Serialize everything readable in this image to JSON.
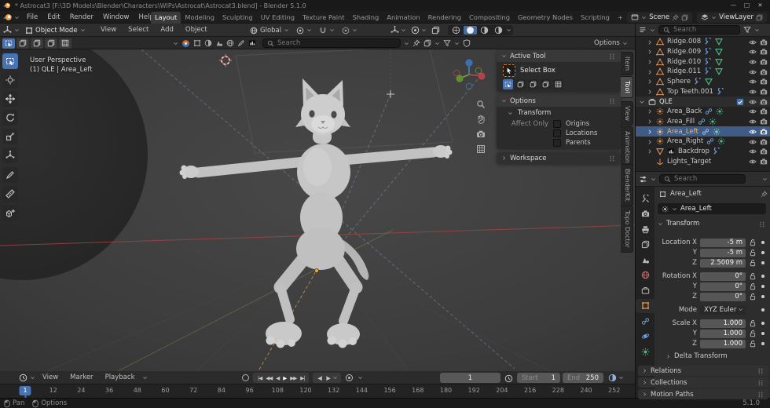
{
  "window": {
    "title": "* Astrocat3 [F:\\3D Models\\Blender\\Characters\\WIPs\\Astrocat\\Astrocat3.blend] - Blender 5.1.0",
    "controls": {
      "minimize": "—",
      "maximize": "□",
      "close": "✕"
    }
  },
  "topbar": {
    "menus": [
      "File",
      "Edit",
      "Render",
      "Window",
      "Help"
    ],
    "workspaces": [
      "Layout",
      "Modeling",
      "Sculpting",
      "UV Editing",
      "Texture Paint",
      "Shading",
      "Animation",
      "Rendering",
      "Compositing",
      "Geometry Nodes",
      "Scripting"
    ],
    "active_workspace": "Layout",
    "add_workspace": "+",
    "scene_label": "Scene",
    "view_layer_label": "ViewLayer"
  },
  "viewport_header": {
    "mode": "Object Mode",
    "menus": [
      "View",
      "Select",
      "Add",
      "Object"
    ],
    "orientation": "Global"
  },
  "tool_settings": {
    "search_placeholder": "Search",
    "options_label": "Options"
  },
  "viewport": {
    "overlay_title": "User Perspective",
    "overlay_subtitle": "(1) QLE | Area_Left"
  },
  "sidebar": {
    "tabs": [
      "Item",
      "Tool",
      "View",
      "Animation",
      "BlenderKit",
      "Topo Doctor"
    ],
    "active_tab": "Tool",
    "active_tool_panel": {
      "title": "Active Tool",
      "tool_name": "Select Box"
    },
    "options_panel": {
      "title": "Options",
      "transform": "Transform",
      "affect_only": "Affect Only",
      "toggles": [
        "Origins",
        "Locations",
        "Parents"
      ]
    },
    "workspace_panel": {
      "title": "Workspace"
    }
  },
  "outliner": {
    "search_placeholder": "Search",
    "items": [
      {
        "name": "Ridge.008",
        "type": "mesh"
      },
      {
        "name": "Ridge.009",
        "type": "mesh"
      },
      {
        "name": "Ridge.010",
        "type": "mesh"
      },
      {
        "name": "Ridge.011",
        "type": "mesh"
      },
      {
        "name": "Sphere",
        "type": "mesh"
      },
      {
        "name": "Top Teeth.001",
        "type": "mesh"
      },
      {
        "name": "QLE",
        "type": "collection",
        "checked": true
      },
      {
        "name": "Area_Back",
        "type": "light"
      },
      {
        "name": "Area_Fill",
        "type": "light"
      },
      {
        "name": "Area_Left",
        "type": "light",
        "selected": true
      },
      {
        "name": "Area_Right",
        "type": "light"
      },
      {
        "name": "Backdrop",
        "type": "mesh"
      },
      {
        "name": "Lights_Target",
        "type": "empty"
      }
    ]
  },
  "properties": {
    "search_placeholder": "Search",
    "breadcrumb": "Area_Left",
    "name_field": "Area_Left",
    "transform": {
      "title": "Transform",
      "rows": [
        {
          "label": "Location X",
          "value": "-5 m"
        },
        {
          "label": "Y",
          "value": "-5 m"
        },
        {
          "label": "Z",
          "value": "2.5009 m"
        },
        {
          "label": "Rotation X",
          "value": "0°"
        },
        {
          "label": "Y",
          "value": "0°"
        },
        {
          "label": "Z",
          "value": "0°"
        },
        {
          "label": "Mode",
          "value": "XYZ Euler"
        },
        {
          "label": "Scale X",
          "value": "1.000"
        },
        {
          "label": "Y",
          "value": "1.000"
        },
        {
          "label": "Z",
          "value": "1.000"
        }
      ],
      "delta": "Delta Transform"
    },
    "panels": [
      "Relations",
      "Collections",
      "Motion Paths"
    ]
  },
  "timeline": {
    "menus": [
      "View",
      "Marker",
      "Playback"
    ],
    "transport": [
      "|◀",
      "◀◀",
      "◀",
      "▶",
      "▶▶",
      "▶|"
    ],
    "step_buttons": [
      "◀|",
      "|▶"
    ],
    "current_frame": "1",
    "start_label": "Start",
    "start_value": "1",
    "end_label": "End",
    "end_value": "250",
    "ruler": [
      "1",
      "12",
      "24",
      "36",
      "48",
      "60",
      "72",
      "84",
      "96",
      "108",
      "120",
      "132",
      "144",
      "156",
      "168",
      "180",
      "192",
      "204",
      "216",
      "228",
      "240",
      "252"
    ]
  },
  "status_bar": {
    "left": [
      "Pan",
      "Options"
    ],
    "version": "5.1.0"
  },
  "colors": {
    "accent": "#4772b3",
    "selection": "#3e5c85",
    "mesh_icon": "#e2935a",
    "data_icon": "#4fbe8b",
    "modifier_icon": "#6f9fd8",
    "active_name": "#ffb659"
  }
}
